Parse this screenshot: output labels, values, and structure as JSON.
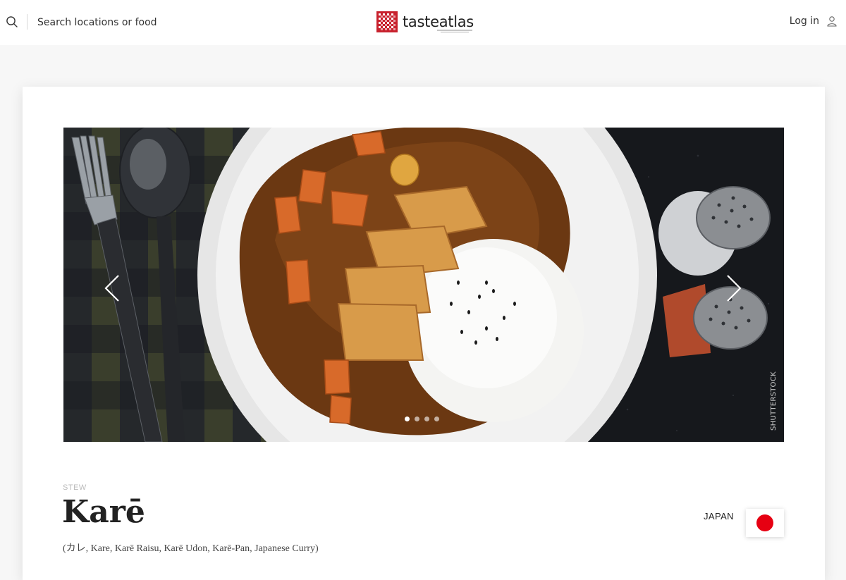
{
  "header": {
    "search_placeholder": "Search locations or food",
    "logo": {
      "text_taste": "taste",
      "text_atlas": "atlas"
    },
    "login_label": "Log in",
    "icons": {
      "search": "search-icon",
      "user": "user-icon",
      "logo": "checkered-logo-icon"
    }
  },
  "hero": {
    "image_credit": "SHUTTERSTOCK",
    "slide_count": 4,
    "active_slide": 1,
    "prev_icon": "chevron-left-icon",
    "next_icon": "chevron-right-icon"
  },
  "dish": {
    "category": "STEW",
    "name": "Karē",
    "alt_names": "(カレ, Kare, Karē Raisu, Karē Udon, Karē-Pan, Japanese Curry)",
    "country": "JAPAN"
  },
  "colors": {
    "brand_red": "#c8212d",
    "flag_red": "#e60012",
    "header_bg": "#ffffff",
    "page_bg": "#f7f7f7"
  }
}
